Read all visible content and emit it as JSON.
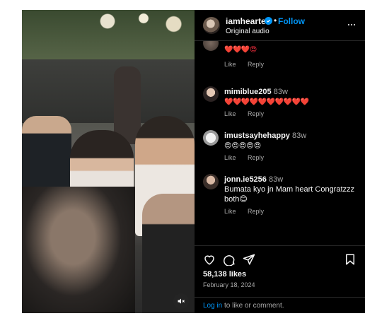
{
  "post": {
    "username": "iamhearte",
    "follow_label": "Follow",
    "separator": "•",
    "audio_label": "Original audio",
    "likes": "58,138 likes",
    "date": "February 18, 2024"
  },
  "comments": [
    {
      "username": "",
      "time": "",
      "text": "❤️❤️❤️😍",
      "like_label": "Like",
      "reply_label": "Reply"
    },
    {
      "username": "mimiblue205",
      "time": "83w",
      "text": "❤️❤️❤️❤️❤️❤️❤️❤️❤️❤️",
      "like_label": "Like",
      "reply_label": "Reply"
    },
    {
      "username": "imustsayhehappy",
      "time": "83w",
      "text": "😍😍😍😍😍",
      "like_label": "Like",
      "reply_label": "Reply"
    },
    {
      "username": "jonn.ie5256",
      "time": "83w",
      "text": "Bumata kyo jn Mam heart Congratzzz both😊",
      "like_label": "Like",
      "reply_label": "Reply"
    }
  ],
  "footer": {
    "login_link": "Log in",
    "login_suffix": " to like or comment."
  },
  "icons": {
    "verified": "verified-badge-icon",
    "more": "more-options-icon",
    "like": "heart-icon",
    "comment": "comment-icon",
    "share": "share-icon",
    "save": "bookmark-icon",
    "mute": "muted-speaker-icon",
    "loading": "loading-spinner-icon"
  },
  "colors": {
    "panel_bg": "#000000",
    "accent": "#0095f6",
    "muted_text": "#a8a8a8",
    "heart": "#ff3040"
  }
}
